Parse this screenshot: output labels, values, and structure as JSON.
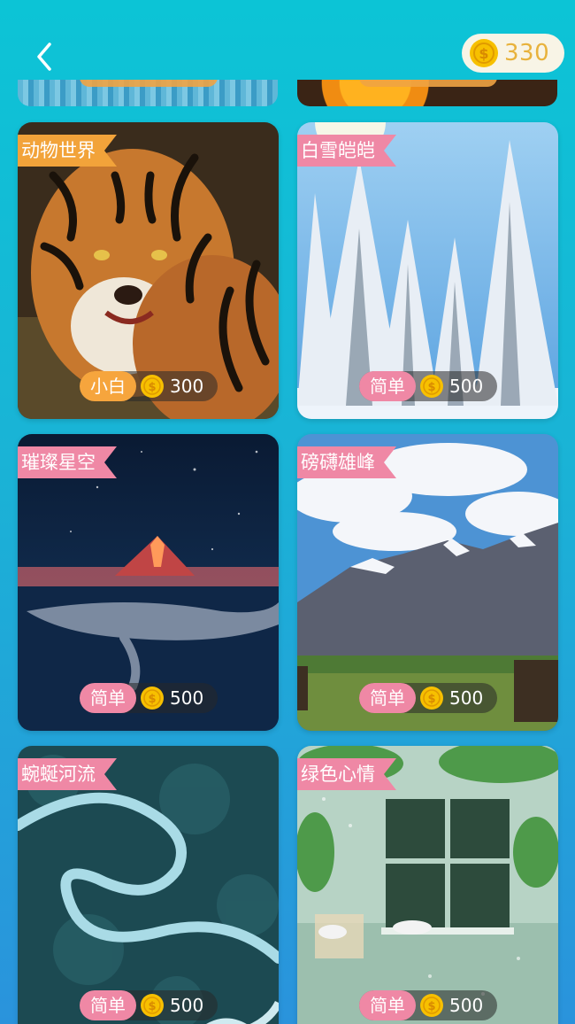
{
  "header": {
    "back_icon": "chevron-left-icon",
    "coins": "330",
    "coin_icon": "gold-coin-icon"
  },
  "colors": {
    "tag_orange": "#f2a33a",
    "tag_pink": "#ef88a5",
    "level_orange": "#f6a53d",
    "level_pink": "#ef88a5",
    "coin_gold": "#f7c000"
  },
  "puzzles": [
    {
      "title": "动物世界",
      "level": "小白",
      "price": "300",
      "theme": "tiger"
    },
    {
      "title": "白雪皑皑",
      "level": "简单",
      "price": "500",
      "theme": "snow-forest"
    },
    {
      "title": "璀璨星空",
      "level": "简单",
      "price": "500",
      "theme": "volcano-whale"
    },
    {
      "title": "磅礴雄峰",
      "level": "简单",
      "price": "500",
      "theme": "mountains"
    },
    {
      "title": "蜿蜒河流",
      "level": "简单",
      "price": "500",
      "theme": "river"
    },
    {
      "title": "绿色心情",
      "level": "简单",
      "price": "500",
      "theme": "green-window"
    }
  ]
}
